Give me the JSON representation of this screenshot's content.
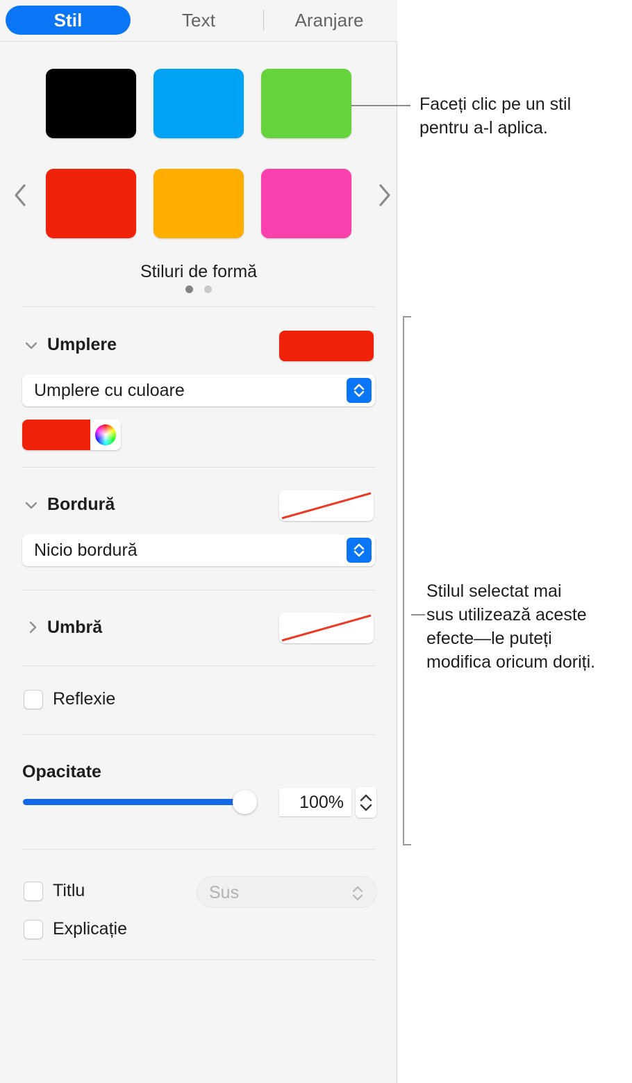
{
  "tabs": [
    {
      "label": "Stil",
      "active": true
    },
    {
      "label": "Text",
      "active": false
    },
    {
      "label": "Aranjare",
      "active": false
    }
  ],
  "gallery": {
    "label": "Stiluri de formă",
    "prev_icon": "chevron-left-icon",
    "next_icon": "chevron-right-icon",
    "swatches": [
      {
        "name": "style-black",
        "color": "#000000"
      },
      {
        "name": "style-blue",
        "color": "#00A2F3"
      },
      {
        "name": "style-green",
        "color": "#64D33C"
      },
      {
        "name": "style-red",
        "color": "#EF2209"
      },
      {
        "name": "style-orange",
        "color": "#FFAE00"
      },
      {
        "name": "style-pink",
        "color": "#FA40AD"
      }
    ],
    "pages": 2,
    "current_page": 1
  },
  "fill": {
    "title": "Umplere",
    "expanded": true,
    "preview_color": "#EF2209",
    "type_value": "Umplere cu culoare",
    "color_value": "#EF2209"
  },
  "border": {
    "title": "Bordură",
    "expanded": true,
    "preview": "none-slash",
    "type_value": "Nicio bordură"
  },
  "shadow": {
    "title": "Umbră",
    "expanded": false,
    "preview": "none-slash"
  },
  "reflection": {
    "label": "Reflexie",
    "checked": false
  },
  "opacity": {
    "label": "Opacitate",
    "value": "100%",
    "percent": 100
  },
  "title_option": {
    "label": "Titlu",
    "checked": false,
    "position_value": "Sus"
  },
  "caption_option": {
    "label": "Explicație",
    "checked": false
  },
  "callouts": [
    {
      "name": "callout-styles",
      "line1": "Faceți clic pe un stil",
      "line2": "pentru a-l aplica."
    },
    {
      "name": "callout-effects",
      "line1": "Stilul selectat mai",
      "line2": "sus utilizează aceste",
      "line3": "efecte—le puteți",
      "line4": "modifica oricum doriți."
    }
  ],
  "colors": {
    "accent": "#0a76f6",
    "slider_fill": "#1368e8",
    "none_slash": "#ED3A25",
    "panel_bg": "#f5f5f5"
  }
}
